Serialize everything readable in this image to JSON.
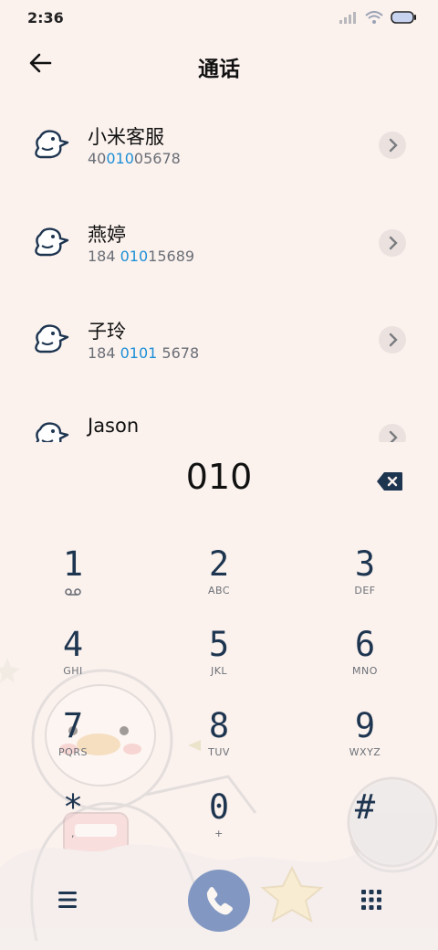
{
  "status_bar": {
    "time": "2:36"
  },
  "header": {
    "title": "通话"
  },
  "contacts": [
    {
      "name": "小米客服",
      "num_parts": [
        "40",
        "010",
        "05678"
      ]
    },
    {
      "name": "燕婷",
      "num_parts": [
        "184 ",
        "010",
        "15689"
      ]
    },
    {
      "name": "子玲",
      "num_parts": [
        "184 ",
        "0101",
        " 5678"
      ]
    },
    {
      "name": "Jason",
      "num_parts": [
        "",
        "",
        ""
      ]
    }
  ],
  "dial": {
    "value": "010"
  },
  "keypad": [
    {
      "digit": "1",
      "letters": ""
    },
    {
      "digit": "2",
      "letters": "ABC"
    },
    {
      "digit": "3",
      "letters": "DEF"
    },
    {
      "digit": "4",
      "letters": "GHI"
    },
    {
      "digit": "5",
      "letters": "JKL"
    },
    {
      "digit": "6",
      "letters": "MNO"
    },
    {
      "digit": "7",
      "letters": "PQRS"
    },
    {
      "digit": "8",
      "letters": "TUV"
    },
    {
      "digit": "9",
      "letters": "WXYZ"
    },
    {
      "digit": "*",
      "letters": ","
    },
    {
      "digit": "0",
      "letters": "+"
    },
    {
      "digit": "#",
      "letters": ""
    }
  ],
  "colors": {
    "accent": "#8298c2",
    "highlight": "#1d8fd6",
    "background": "#fbf2ee"
  },
  "icons": {
    "back": "arrow-left-icon",
    "delete": "backspace-icon",
    "call": "phone-icon",
    "menu": "hamburger-icon",
    "grid": "dialpad-icon"
  }
}
